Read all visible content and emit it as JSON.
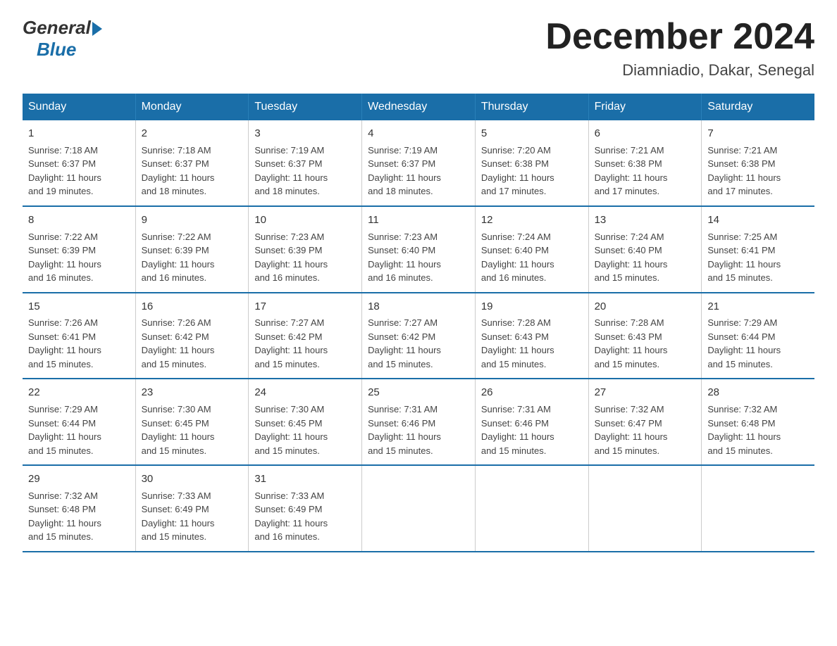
{
  "logo": {
    "general": "General",
    "blue": "Blue"
  },
  "title": "December 2024",
  "subtitle": "Diamniadio, Dakar, Senegal",
  "weekdays": [
    "Sunday",
    "Monday",
    "Tuesday",
    "Wednesday",
    "Thursday",
    "Friday",
    "Saturday"
  ],
  "weeks": [
    [
      {
        "day": "1",
        "info": "Sunrise: 7:18 AM\nSunset: 6:37 PM\nDaylight: 11 hours\nand 19 minutes."
      },
      {
        "day": "2",
        "info": "Sunrise: 7:18 AM\nSunset: 6:37 PM\nDaylight: 11 hours\nand 18 minutes."
      },
      {
        "day": "3",
        "info": "Sunrise: 7:19 AM\nSunset: 6:37 PM\nDaylight: 11 hours\nand 18 minutes."
      },
      {
        "day": "4",
        "info": "Sunrise: 7:19 AM\nSunset: 6:37 PM\nDaylight: 11 hours\nand 18 minutes."
      },
      {
        "day": "5",
        "info": "Sunrise: 7:20 AM\nSunset: 6:38 PM\nDaylight: 11 hours\nand 17 minutes."
      },
      {
        "day": "6",
        "info": "Sunrise: 7:21 AM\nSunset: 6:38 PM\nDaylight: 11 hours\nand 17 minutes."
      },
      {
        "day": "7",
        "info": "Sunrise: 7:21 AM\nSunset: 6:38 PM\nDaylight: 11 hours\nand 17 minutes."
      }
    ],
    [
      {
        "day": "8",
        "info": "Sunrise: 7:22 AM\nSunset: 6:39 PM\nDaylight: 11 hours\nand 16 minutes."
      },
      {
        "day": "9",
        "info": "Sunrise: 7:22 AM\nSunset: 6:39 PM\nDaylight: 11 hours\nand 16 minutes."
      },
      {
        "day": "10",
        "info": "Sunrise: 7:23 AM\nSunset: 6:39 PM\nDaylight: 11 hours\nand 16 minutes."
      },
      {
        "day": "11",
        "info": "Sunrise: 7:23 AM\nSunset: 6:40 PM\nDaylight: 11 hours\nand 16 minutes."
      },
      {
        "day": "12",
        "info": "Sunrise: 7:24 AM\nSunset: 6:40 PM\nDaylight: 11 hours\nand 16 minutes."
      },
      {
        "day": "13",
        "info": "Sunrise: 7:24 AM\nSunset: 6:40 PM\nDaylight: 11 hours\nand 15 minutes."
      },
      {
        "day": "14",
        "info": "Sunrise: 7:25 AM\nSunset: 6:41 PM\nDaylight: 11 hours\nand 15 minutes."
      }
    ],
    [
      {
        "day": "15",
        "info": "Sunrise: 7:26 AM\nSunset: 6:41 PM\nDaylight: 11 hours\nand 15 minutes."
      },
      {
        "day": "16",
        "info": "Sunrise: 7:26 AM\nSunset: 6:42 PM\nDaylight: 11 hours\nand 15 minutes."
      },
      {
        "day": "17",
        "info": "Sunrise: 7:27 AM\nSunset: 6:42 PM\nDaylight: 11 hours\nand 15 minutes."
      },
      {
        "day": "18",
        "info": "Sunrise: 7:27 AM\nSunset: 6:42 PM\nDaylight: 11 hours\nand 15 minutes."
      },
      {
        "day": "19",
        "info": "Sunrise: 7:28 AM\nSunset: 6:43 PM\nDaylight: 11 hours\nand 15 minutes."
      },
      {
        "day": "20",
        "info": "Sunrise: 7:28 AM\nSunset: 6:43 PM\nDaylight: 11 hours\nand 15 minutes."
      },
      {
        "day": "21",
        "info": "Sunrise: 7:29 AM\nSunset: 6:44 PM\nDaylight: 11 hours\nand 15 minutes."
      }
    ],
    [
      {
        "day": "22",
        "info": "Sunrise: 7:29 AM\nSunset: 6:44 PM\nDaylight: 11 hours\nand 15 minutes."
      },
      {
        "day": "23",
        "info": "Sunrise: 7:30 AM\nSunset: 6:45 PM\nDaylight: 11 hours\nand 15 minutes."
      },
      {
        "day": "24",
        "info": "Sunrise: 7:30 AM\nSunset: 6:45 PM\nDaylight: 11 hours\nand 15 minutes."
      },
      {
        "day": "25",
        "info": "Sunrise: 7:31 AM\nSunset: 6:46 PM\nDaylight: 11 hours\nand 15 minutes."
      },
      {
        "day": "26",
        "info": "Sunrise: 7:31 AM\nSunset: 6:46 PM\nDaylight: 11 hours\nand 15 minutes."
      },
      {
        "day": "27",
        "info": "Sunrise: 7:32 AM\nSunset: 6:47 PM\nDaylight: 11 hours\nand 15 minutes."
      },
      {
        "day": "28",
        "info": "Sunrise: 7:32 AM\nSunset: 6:48 PM\nDaylight: 11 hours\nand 15 minutes."
      }
    ],
    [
      {
        "day": "29",
        "info": "Sunrise: 7:32 AM\nSunset: 6:48 PM\nDaylight: 11 hours\nand 15 minutes."
      },
      {
        "day": "30",
        "info": "Sunrise: 7:33 AM\nSunset: 6:49 PM\nDaylight: 11 hours\nand 15 minutes."
      },
      {
        "day": "31",
        "info": "Sunrise: 7:33 AM\nSunset: 6:49 PM\nDaylight: 11 hours\nand 16 minutes."
      },
      null,
      null,
      null,
      null
    ]
  ]
}
